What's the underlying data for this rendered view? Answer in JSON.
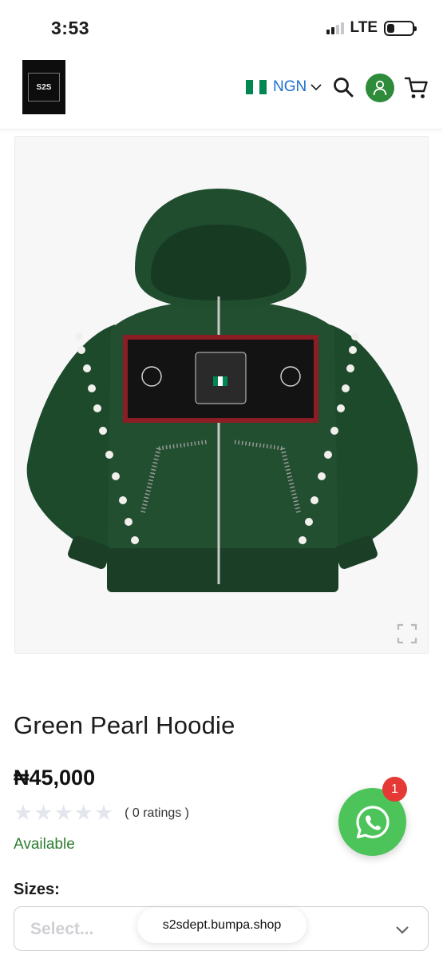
{
  "status_bar": {
    "time": "3:53",
    "network": "LTE",
    "battery_level": 0.3
  },
  "header": {
    "logo_text": "S2S",
    "currency": {
      "code": "NGN",
      "flag_colors": [
        "#008751",
        "#ffffff",
        "#008751"
      ]
    },
    "icons": [
      "search-icon",
      "user-icon",
      "cart-icon"
    ]
  },
  "product": {
    "title": "Green Pearl Hoodie",
    "price": "₦45,000",
    "rating": {
      "stars": 0,
      "max_stars": 5,
      "count_text": "( 0 ratings )"
    },
    "availability": "Available",
    "sizes_label": "Sizes:",
    "size_select_placeholder": "Select..."
  },
  "browser": {
    "url": "s2sdept.bumpa.shop"
  },
  "whatsapp": {
    "badge_count": "1"
  },
  "colors": {
    "accent_blue": "#1f6fd1",
    "avatar_green": "#2e8b3a",
    "available_green": "#2e7d32",
    "whatsapp_green": "#4cc45a",
    "badge_red": "#e53935",
    "hoodie_green": "#1f4a2c"
  }
}
